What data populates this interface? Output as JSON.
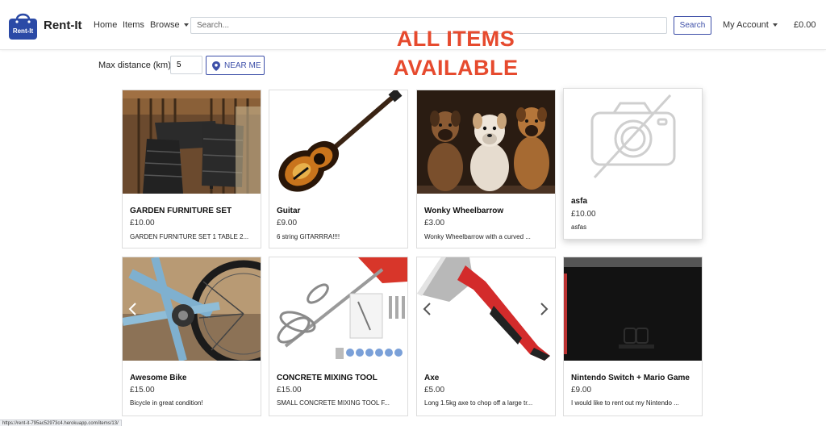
{
  "brand": {
    "name": "Rent-It",
    "logo_text": "Rent-It"
  },
  "nav": {
    "home": "Home",
    "items": "Items",
    "browse": "Browse",
    "search_placeholder": "Search...",
    "search_button": "Search",
    "account": "My Account",
    "cart_total": "£0.00"
  },
  "headline": {
    "line1": "ALL ITEMS",
    "line2": "AVAILABLE"
  },
  "filter": {
    "label": "Max distance (km)",
    "value": "5",
    "near_me": "NEAR ME"
  },
  "items": [
    {
      "title": "GARDEN FURNITURE SET",
      "price": "£10.00",
      "desc": "GARDEN FURNITURE SET 1 TABLE 2...",
      "image": "garden-furniture-photo"
    },
    {
      "title": "Guitar",
      "price": "£9.00",
      "desc": "6 string GITARRRA!!!!",
      "image": "guitar-photo"
    },
    {
      "title": "Wonky Wheelbarrow",
      "price": "£3.00",
      "desc": "Wonky Wheelbarrow with a curved ...",
      "image": "dogs-photo"
    },
    {
      "title": "asfa",
      "price": "£10.00",
      "desc": "asfas",
      "image": "no-image-placeholder"
    },
    {
      "title": "Awesome Bike",
      "price": "£15.00",
      "desc": "Bicycle in great condition!",
      "image": "bike-photo"
    },
    {
      "title": "CONCRETE MIXING TOOL",
      "price": "£15.00",
      "desc": "SMALL CONCRETE MIXING TOOL F...",
      "image": "mixing-tool-photo"
    },
    {
      "title": "Axe",
      "price": "£5.00",
      "desc": "Long 1.5kg axe to chop off a large tr...",
      "image": "axe-photo"
    },
    {
      "title": "Nintendo Switch + Mario Game",
      "price": "£9.00",
      "desc": "I would like to rent out my Nintendo ...",
      "image": "nintendo-switch-photo"
    }
  ],
  "status_url": "https://rent-it-795ac52973c4.herokuapp.com/items/13/",
  "colors": {
    "accent": "#3d4fa8",
    "headline": "#e64a2e",
    "logo_bg": "#2b4aa6"
  }
}
